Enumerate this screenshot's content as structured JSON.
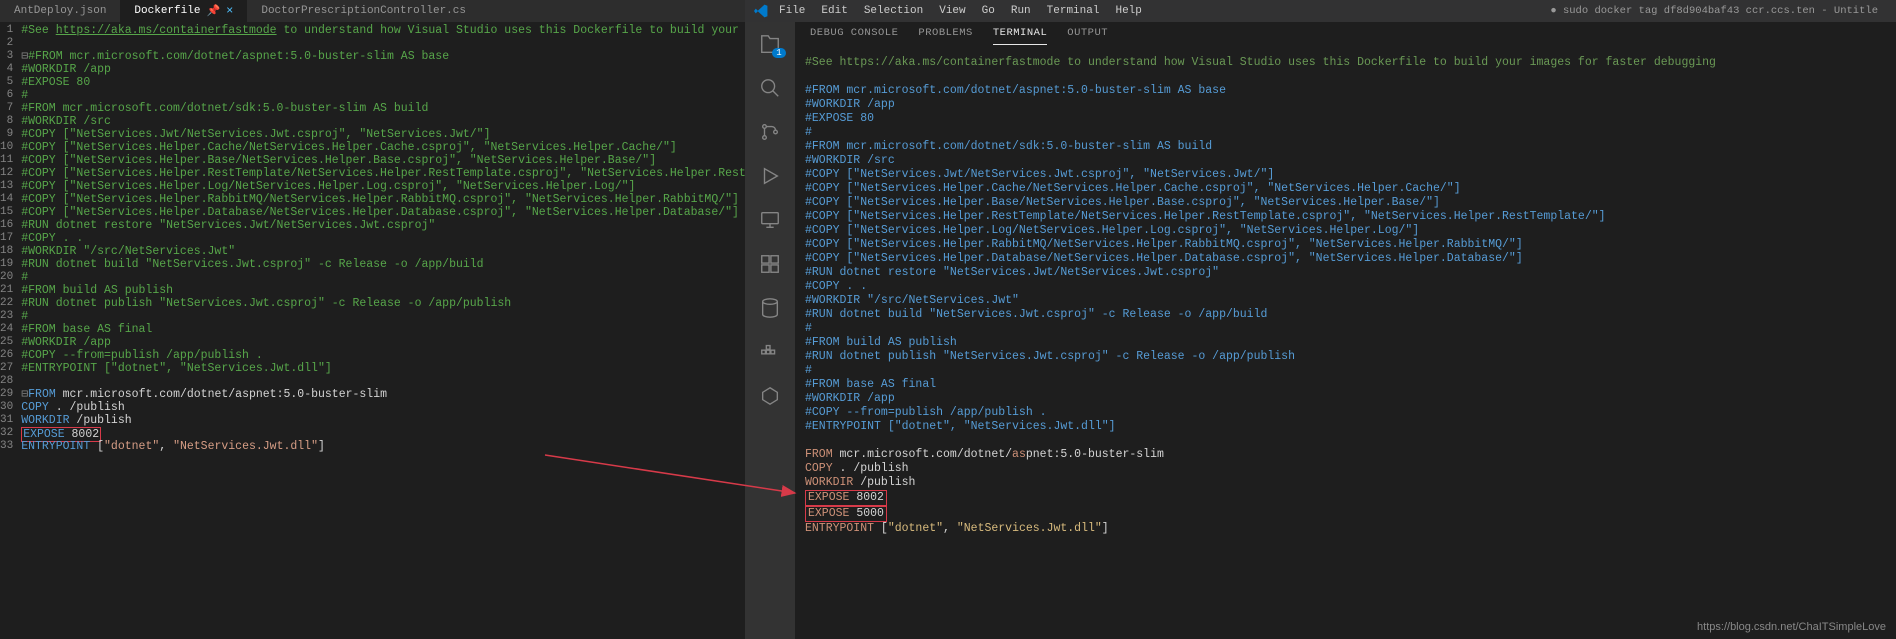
{
  "left": {
    "tabs": [
      {
        "label": "AntDeploy.json",
        "active": false
      },
      {
        "label": "Dockerfile",
        "active": true,
        "close_icon": "×"
      },
      {
        "label": "DoctorPrescriptionController.cs",
        "active": false
      }
    ],
    "lines": [
      {
        "n": 1,
        "html": "<span class='c-comment'>#See </span><span class='c-link'>https://aka.ms/containerfastmode</span><span class='c-comment'> to understand how Visual Studio uses this Dockerfile to build your images for f</span>"
      },
      {
        "n": 2,
        "html": ""
      },
      {
        "n": 3,
        "html": "<span class='fold'>⊟</span><span class='c-comment'>#FROM mcr.microsoft.com/dotnet/aspnet:5.0-buster-slim AS base</span>"
      },
      {
        "n": 4,
        "html": "<span class='c-comment'>#WORKDIR /app</span>"
      },
      {
        "n": 5,
        "html": "<span class='c-comment'>#EXPOSE 80</span>"
      },
      {
        "n": 6,
        "html": "<span class='c-comment'>#</span>"
      },
      {
        "n": 7,
        "html": "<span class='c-comment'>#FROM mcr.microsoft.com/dotnet/sdk:5.0-buster-slim AS build</span>"
      },
      {
        "n": 8,
        "html": "<span class='c-comment'>#WORKDIR /src</span>"
      },
      {
        "n": 9,
        "html": "<span class='c-comment'>#COPY [\"NetServices.Jwt/NetServices.Jwt.csproj\", \"NetServices.Jwt/\"]</span>"
      },
      {
        "n": 10,
        "html": "<span class='c-comment'>#COPY [\"NetServices.Helper.Cache/NetServices.Helper.Cache.csproj\", \"NetServices.Helper.Cache/\"]</span>"
      },
      {
        "n": 11,
        "html": "<span class='c-comment'>#COPY [\"NetServices.Helper.Base/NetServices.Helper.Base.csproj\", \"NetServices.Helper.Base/\"]</span>"
      },
      {
        "n": 12,
        "html": "<span class='c-comment'>#COPY [\"NetServices.Helper.RestTemplate/NetServices.Helper.RestTemplate.csproj\", \"NetServices.Helper.RestTemplate/\"]</span>"
      },
      {
        "n": 13,
        "html": "<span class='c-comment'>#COPY [\"NetServices.Helper.Log/NetServices.Helper.Log.csproj\", \"NetServices.Helper.Log/\"]</span>"
      },
      {
        "n": 14,
        "html": "<span class='c-comment'>#COPY [\"NetServices.Helper.RabbitMQ/NetServices.Helper.RabbitMQ.csproj\", \"NetServices.Helper.RabbitMQ/\"]</span>"
      },
      {
        "n": 15,
        "html": "<span class='c-comment'>#COPY [\"NetServices.Helper.Database/NetServices.Helper.Database.csproj\", \"NetServices.Helper.Database/\"]</span>"
      },
      {
        "n": 16,
        "html": "<span class='c-comment'>#RUN dotnet restore \"NetServices.Jwt/NetServices.Jwt.csproj\"</span>"
      },
      {
        "n": 17,
        "html": "<span class='c-comment'>#COPY . .</span>"
      },
      {
        "n": 18,
        "html": "<span class='c-comment'>#WORKDIR \"/src/NetServices.Jwt\"</span>"
      },
      {
        "n": 19,
        "html": "<span class='c-comment'>#RUN dotnet build \"NetServices.Jwt.csproj\" -c Release -o /app/build</span>"
      },
      {
        "n": 20,
        "html": "<span class='c-comment'>#</span>"
      },
      {
        "n": 21,
        "html": "<span class='c-comment'>#FROM build AS publish</span>"
      },
      {
        "n": 22,
        "html": "<span class='c-comment'>#RUN dotnet publish \"NetServices.Jwt.csproj\" -c Release -o /app/publish</span>"
      },
      {
        "n": 23,
        "html": "<span class='c-comment'>#</span>"
      },
      {
        "n": 24,
        "html": "<span class='c-comment'>#FROM base AS final</span>"
      },
      {
        "n": 25,
        "html": "<span class='c-comment'>#WORKDIR /app</span>"
      },
      {
        "n": 26,
        "html": "<span class='c-comment'>#COPY --from=publish /app/publish .</span>"
      },
      {
        "n": 27,
        "html": "<span class='c-comment'>#ENTRYPOINT [\"dotnet\", \"NetServices.Jwt.dll\"]</span>"
      },
      {
        "n": 28,
        "html": ""
      },
      {
        "n": 29,
        "html": "<span class='fold'>⊟</span><span class='c-kw'>FROM</span> mcr.microsoft.com/dotnet/aspnet:5.0-buster-slim"
      },
      {
        "n": 30,
        "html": "<span class='c-kw'>COPY</span> . /publish"
      },
      {
        "n": 31,
        "html": "<span class='c-kw'>WORKDIR</span> /publish"
      },
      {
        "n": 32,
        "html": "<span class='hl-box'><span class='c-kw'>EXPOSE</span> 8002</span>"
      },
      {
        "n": 33,
        "html": "<span class='c-kw'>ENTRYPOINT</span> [<span class='c-str'>\"dotnet\"</span>, <span class='c-str'>\"NetServices.Jwt.dll\"</span>]"
      }
    ]
  },
  "right": {
    "menu": [
      "File",
      "Edit",
      "Selection",
      "View",
      "Go",
      "Run",
      "Terminal",
      "Help"
    ],
    "title_right": "● sudo docker tag df8d904baf43 ccr.ccs.ten     - Untitle",
    "activity_badge": "1",
    "panel_tabs": [
      {
        "label": "DEBUG CONSOLE",
        "active": false
      },
      {
        "label": "PROBLEMS",
        "active": false
      },
      {
        "label": "TERMINAL",
        "active": true
      },
      {
        "label": "OUTPUT",
        "active": false
      }
    ],
    "terminal_lines": [
      "<span class='t-comment'>#See https://aka.ms/containerfastmode to understand how Visual Studio uses this Dockerfile to build your images for faster debugging</span>",
      "",
      "<span class='t-blue'>#FROM mcr.microsoft.com/dotnet/aspnet:5.0-buster-slim AS base</span>",
      "<span class='t-blue'>#WORKDIR /app</span>",
      "<span class='t-blue'>#EXPOSE 80</span>",
      "<span class='t-blue'>#</span>",
      "<span class='t-blue'>#FROM mcr.microsoft.com/dotnet/sdk:5.0-buster-slim AS build</span>",
      "<span class='t-blue'>#WORKDIR /src</span>",
      "<span class='t-blue'>#COPY [\"NetServices.Jwt/NetServices.Jwt.csproj\", \"NetServices.Jwt/\"]</span>",
      "<span class='t-blue'>#COPY [\"NetServices.Helper.Cache/NetServices.Helper.Cache.csproj\", \"NetServices.Helper.Cache/\"]</span>",
      "<span class='t-blue'>#COPY [\"NetServices.Helper.Base/NetServices.Helper.Base.csproj\", \"NetServices.Helper.Base/\"]</span>",
      "<span class='t-blue'>#COPY [\"NetServices.Helper.RestTemplate/NetServices.Helper.RestTemplate.csproj\", \"NetServices.Helper.RestTemplate/\"]</span>",
      "<span class='t-blue'>#COPY [\"NetServices.Helper.Log/NetServices.Helper.Log.csproj\", \"NetServices.Helper.Log/\"]</span>",
      "<span class='t-blue'>#COPY [\"NetServices.Helper.RabbitMQ/NetServices.Helper.RabbitMQ.csproj\", \"NetServices.Helper.RabbitMQ/\"]</span>",
      "<span class='t-blue'>#COPY [\"NetServices.Helper.Database/NetServices.Helper.Database.csproj\", \"NetServices.Helper.Database/\"]</span>",
      "<span class='t-blue'>#RUN dotnet restore \"NetServices.Jwt/NetServices.Jwt.csproj\"</span>",
      "<span class='t-blue'>#COPY . .</span>",
      "<span class='t-blue'>#WORKDIR \"/src/NetServices.Jwt\"</span>",
      "<span class='t-blue'>#RUN dotnet build \"NetServices.Jwt.csproj\" -c Release -o /app/build</span>",
      "<span class='t-blue'>#</span>",
      "<span class='t-blue'>#FROM build AS publish</span>",
      "<span class='t-blue'>#RUN dotnet publish \"NetServices.Jwt.csproj\" -c Release -o /app/publish</span>",
      "<span class='t-blue'>#</span>",
      "<span class='t-blue'>#FROM base AS final</span>",
      "<span class='t-blue'>#WORKDIR /app</span>",
      "<span class='t-blue'>#COPY --from=publish /app/publish .</span>",
      "<span class='t-blue'>#ENTRYPOINT [\"dotnet\", \"NetServices.Jwt.dll\"]</span>",
      "",
      "<span class='t-orange'>FROM</span><span class='t-white'> mcr.microsoft.com/dotnet/</span><span class='t-orange'>as</span><span class='t-white'>pnet:5.0-buster-slim</span>",
      "<span class='t-orange'>COPY</span><span class='t-white'> . /publish</span>",
      "<span class='t-orange'>WORKDIR</span><span class='t-white'> /publish</span>",
      "<span class='red-box'><span class='t-orange'>EXPOSE</span><span class='t-white'> 8002</span></span>",
      "<span class='red-box'><span class='t-orange'>EXPOSE</span><span class='t-white'> 5000</span></span>",
      "<span class='t-orange'>ENTRYPOINT</span><span class='t-white'> [</span><span class='t-yellow'>\"dotnet\"</span><span class='t-white'>, </span><span class='t-yellow'>\"NetServices.Jwt.dll\"</span><span class='t-white'>]</span>"
    ]
  },
  "watermark": "https://blog.csdn.net/ChaITSimpleLove"
}
